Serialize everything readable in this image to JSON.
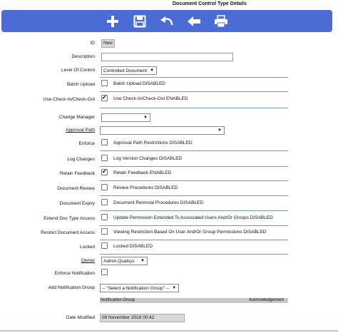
{
  "title": "Document Control Type Details",
  "toolbar": {
    "icons": [
      "plus-icon",
      "save-icon",
      "undo-icon",
      "back-arrow-icon",
      "print-icon"
    ]
  },
  "fields": {
    "id": {
      "label": "ID",
      "value": "New"
    },
    "description": {
      "label": "Description",
      "value": ""
    },
    "level_of_control": {
      "label": "Level Of Control",
      "value": "Controlled Document"
    },
    "batch_upload": {
      "label": "Batch Upload",
      "text": "Batch Upload DISABLED",
      "checked": false
    },
    "checkin": {
      "label": "Use Check-In/Check-Out",
      "text": "Use Check-In/Check-Out ENABLED",
      "checked": true
    },
    "change_manager": {
      "label": "Change Manager",
      "value": ""
    },
    "approval_path": {
      "label": "Approval Path",
      "value": ""
    },
    "enforce": {
      "label": "Enforce",
      "text": "Approval Path Restrictions DISABLED",
      "checked": false
    },
    "log_changes": {
      "label": "Log Changes",
      "text": "Log Version Changes DISABLED",
      "checked": false
    },
    "retain_feedback": {
      "label": "Retain Feedback",
      "text": "Retain Feedback ENABLED",
      "checked": true
    },
    "document_review": {
      "label": "Document Review",
      "text": "Review Procedures DISABLED",
      "checked": false
    },
    "document_expiry": {
      "label": "Document Expiry",
      "text": "Document Removal Procedures DISABLED",
      "checked": false
    },
    "extend_access": {
      "label": "Extend Doc Type Access",
      "text": "Update Permission Extended To Associated Users And/Or Groups DISABLED",
      "checked": false
    },
    "restrict_access": {
      "label": "Restrict Document Access",
      "text": "Viewing Restriction Based On User And/Or Group Permissions DISABLED",
      "checked": false
    },
    "locked": {
      "label": "Locked",
      "text": "Locked DISABLED",
      "checked": false
    },
    "owner": {
      "label": "Owner",
      "value": "Admin,Qualsys"
    },
    "enforce_notification": {
      "label": "Enforce Notification",
      "checked": false
    },
    "add_notification_group": {
      "label": "Add Notification Group",
      "value": "-- \"Select a Notification Group\" --"
    },
    "date_modified": {
      "label": "Date Modified",
      "value": "08 November 2018 00:42"
    }
  },
  "notification_table": {
    "columns": [
      "Notification Group",
      "Acknowledgement"
    ]
  }
}
